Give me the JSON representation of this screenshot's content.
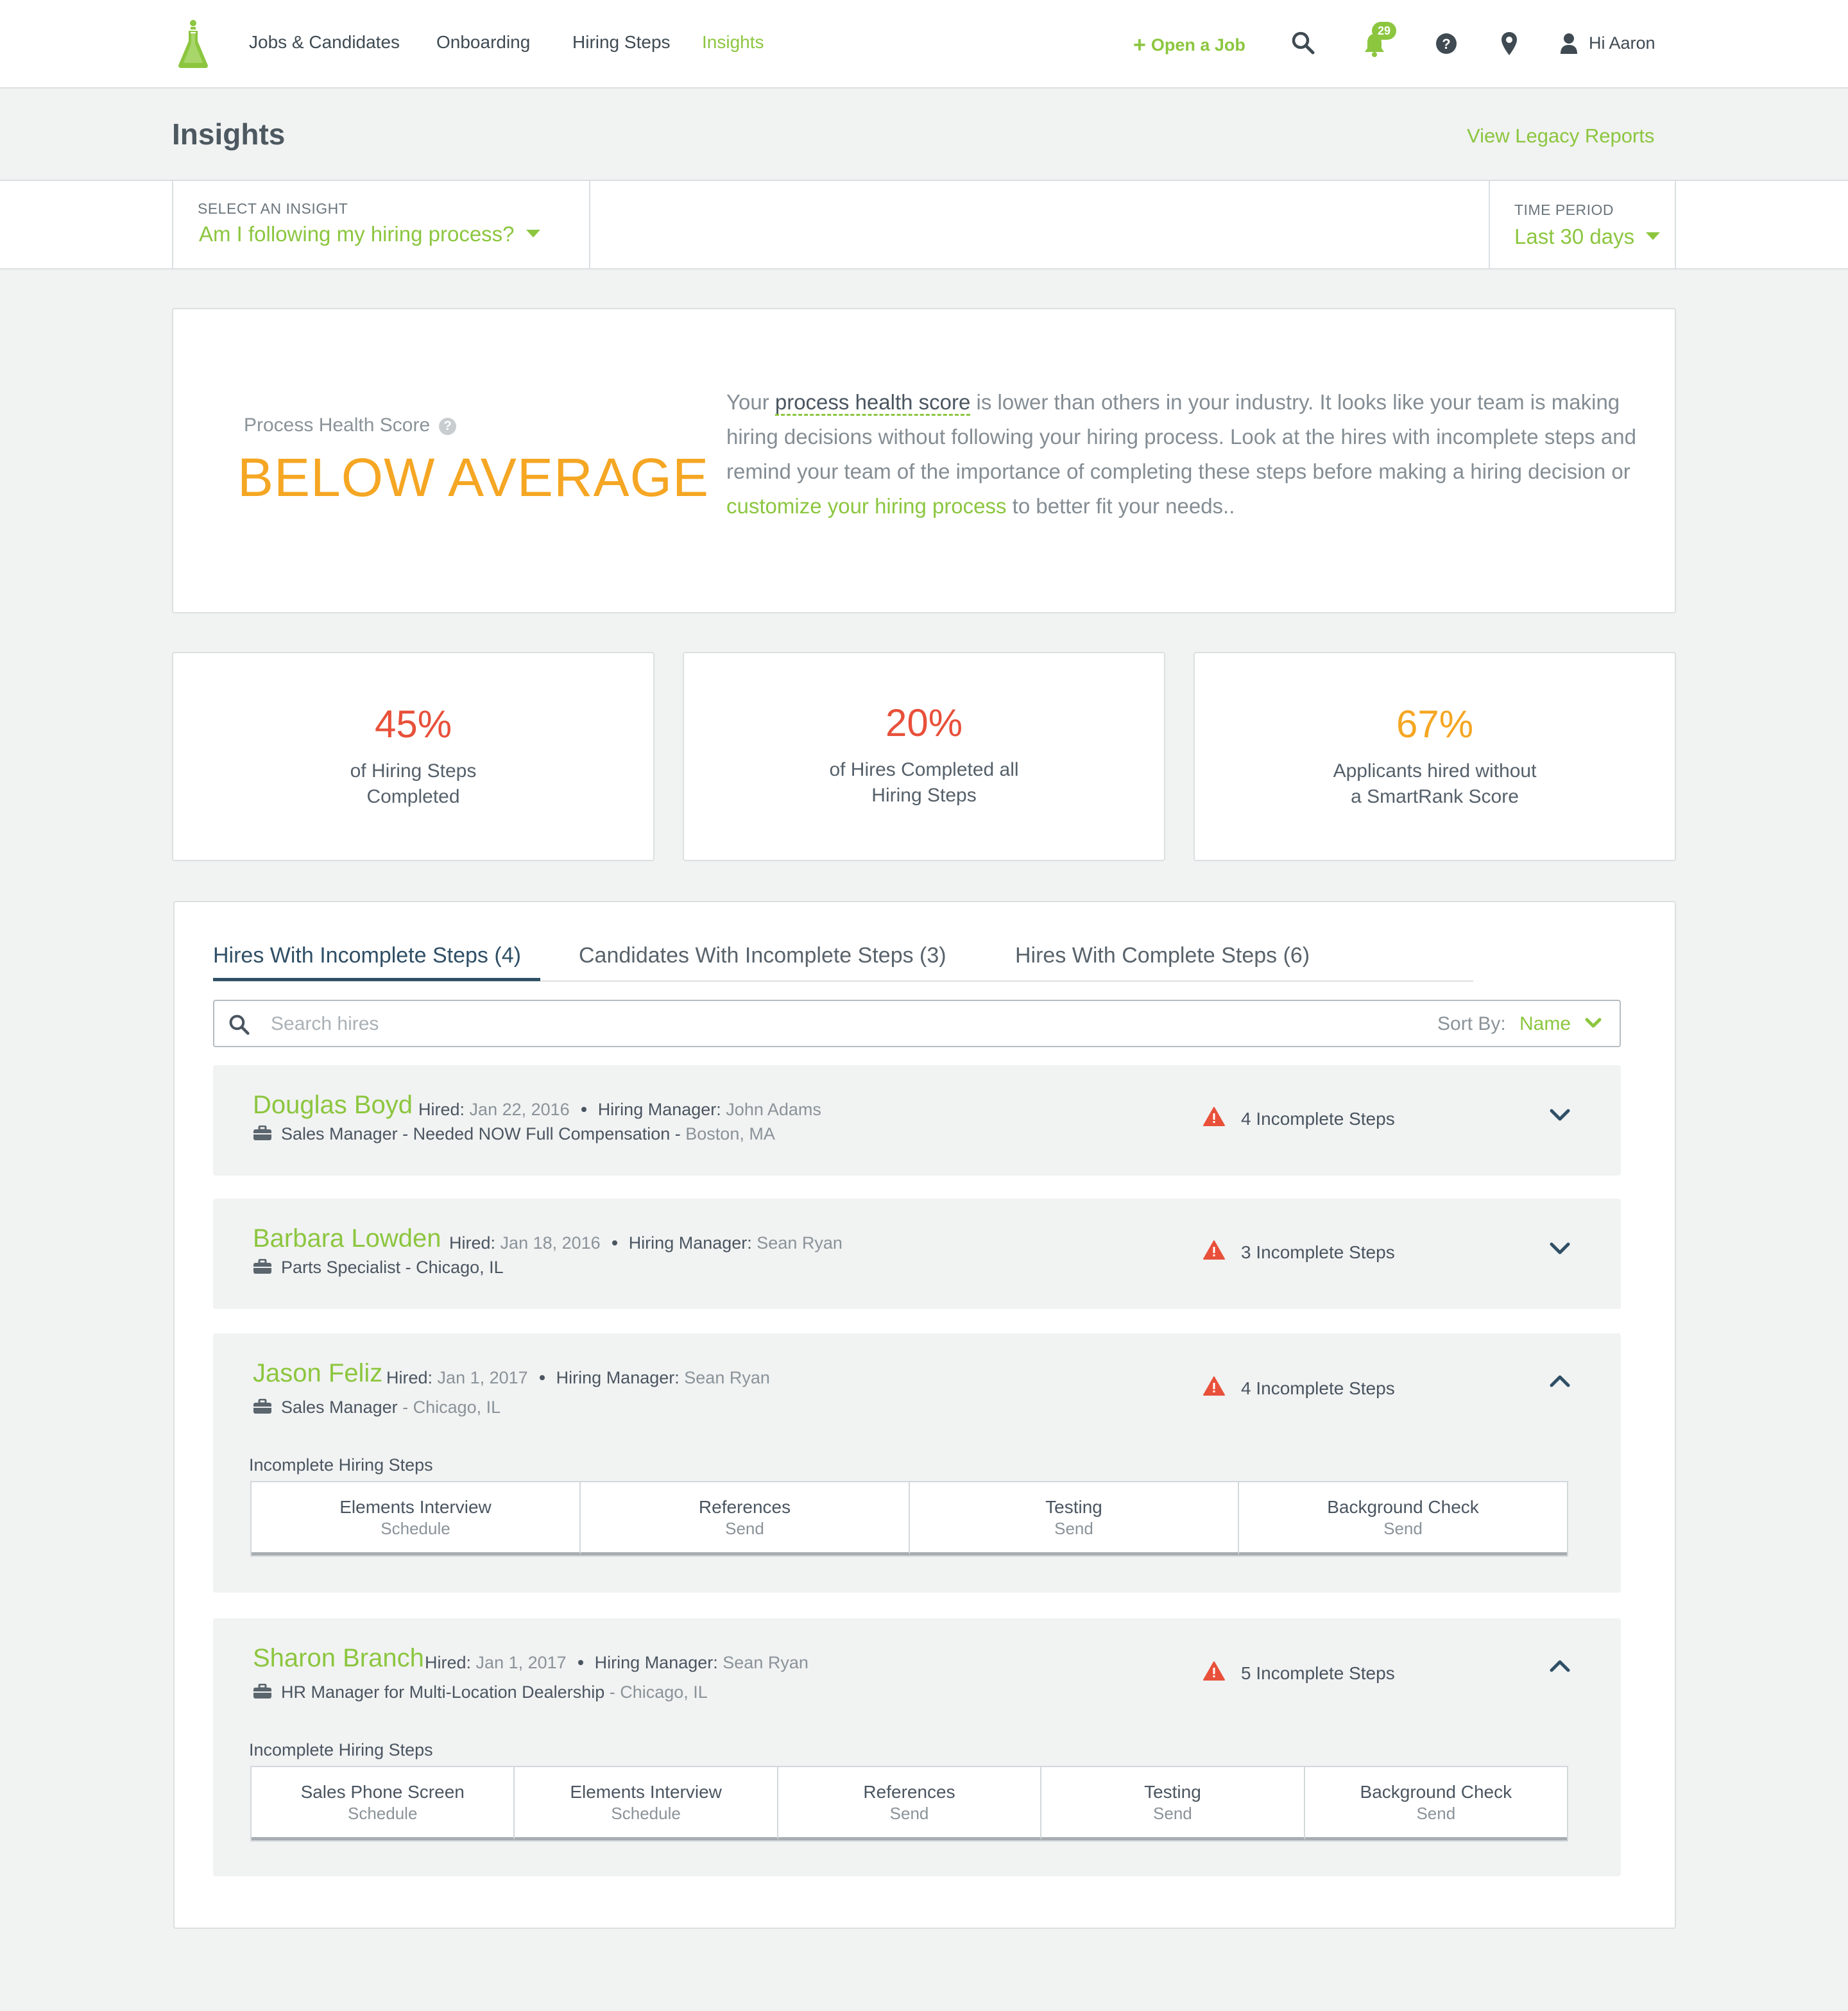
{
  "nav": {
    "links": [
      "Jobs & Candidates",
      "Onboarding",
      "Hiring Steps",
      "Insights"
    ],
    "open_job": "Open a Job",
    "notification_count": "29",
    "user_greeting": "Hi Aaron",
    "accent_color": "#8cc63f"
  },
  "header": {
    "title": "Insights",
    "legacy_link": "View Legacy Reports"
  },
  "filters": {
    "insight_label": "SELECT AN INSIGHT",
    "insight_value": "Am I following my hiring process?",
    "period_label": "TIME PERIOD",
    "period_value": "Last 30 days"
  },
  "health": {
    "label": "Process Health Score",
    "score": "BELOW AVERAGE",
    "text_1": "Your ",
    "link_1": "process health score",
    "text_2": " is lower than others in your industry. It looks like your team is making hiring decisions without following your hiring process. Look at the hires with incomplete steps and remind your team of the importance of completing these steps before making a hiring decision or ",
    "link_2": "customize your hiring process",
    "text_3": " to better fit your needs..",
    "score_color": "#f5a623"
  },
  "stats": [
    {
      "value": "45%",
      "line1": "of Hiring Steps",
      "line2": "Completed",
      "color": "#e8503a"
    },
    {
      "value": "20%",
      "line1": "of Hires Completed all",
      "line2": "Hiring Steps",
      "color": "#e8503a"
    },
    {
      "value": "67%",
      "line1": "Applicants hired without",
      "line2": "a SmartRank Score",
      "color": "#f5a623"
    }
  ],
  "tabs": [
    "Hires With Incomplete Steps (4)",
    "Candidates With Incomplete Steps (3)",
    "Hires With Complete Steps (6)"
  ],
  "search": {
    "placeholder": "Search hires",
    "sort_label": "Sort By:",
    "sort_value": "Name"
  },
  "labels": {
    "hired": "Hired:",
    "manager": "Hiring Manager:",
    "steps_heading": "Incomplete Hiring Steps"
  },
  "hires": [
    {
      "name": "Douglas Boyd",
      "hired_date": "Jan 22, 2016",
      "manager": "John Adams",
      "job": "Sales Manager - Needed NOW Full Compensation -",
      "location": " Boston, MA",
      "incomplete": "4 Incomplete Steps",
      "expanded": false
    },
    {
      "name": "Barbara Lowden",
      "hired_date": "Jan 18, 2016",
      "manager": "Sean Ryan",
      "job": "Parts Specialist - Chicago, IL",
      "location": "",
      "incomplete": "3 Incomplete Steps",
      "expanded": false
    },
    {
      "name": "Jason Feliz",
      "hired_date": "Jan 1, 2017",
      "manager": "Sean Ryan",
      "job": "Sales Manager",
      "location": " - Chicago, IL",
      "incomplete": "4 Incomplete Steps",
      "expanded": true,
      "steps": [
        {
          "name": "Elements Interview",
          "action": "Schedule"
        },
        {
          "name": "References",
          "action": "Send"
        },
        {
          "name": "Testing",
          "action": "Send"
        },
        {
          "name": "Background Check",
          "action": "Send"
        }
      ]
    },
    {
      "name": "Sharon Branch",
      "hired_date": "Jan 1, 2017",
      "manager": "Sean Ryan",
      "job": "HR Manager for Multi-Location Dealership",
      "location": " - Chicago, IL",
      "incomplete": "5 Incomplete Steps",
      "expanded": true,
      "steps": [
        {
          "name": "Sales Phone Screen",
          "action": "Schedule"
        },
        {
          "name": "Elements Interview",
          "action": "Schedule"
        },
        {
          "name": "References",
          "action": "Send"
        },
        {
          "name": "Testing",
          "action": "Send"
        },
        {
          "name": "Background Check",
          "action": "Send"
        }
      ]
    }
  ]
}
